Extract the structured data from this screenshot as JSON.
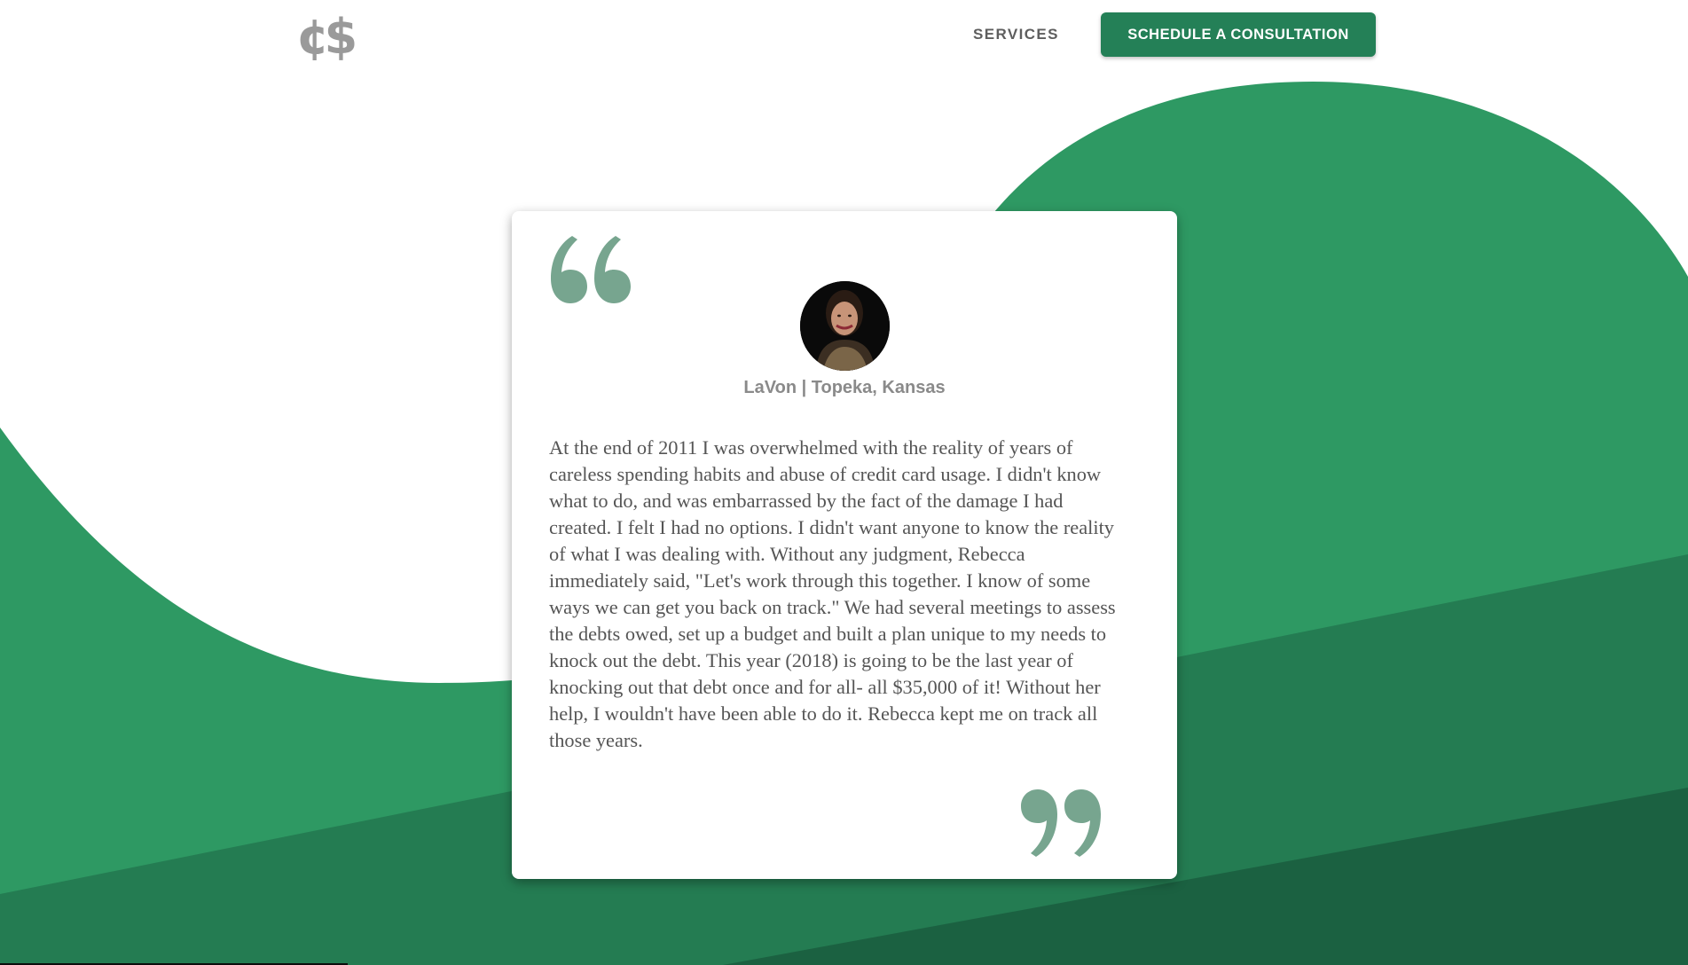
{
  "header": {
    "logo_text": "¢$",
    "nav_services": "SERVICES",
    "cta_label": "SCHEDULE A CONSULTATION"
  },
  "testimonial": {
    "author": "LaVon | Topeka, Kansas",
    "text": "At the end of 2011 I was overwhelmed with the reality of years of careless spending habits and abuse of credit card usage. I didn't know what to do, and was embarrassed by the fact of the damage I had created. I felt I had no options. I didn't want anyone to know the reality of what I was dealing with. Without any judgment, Rebecca immediately said, \"Let's work through this together. I know of some ways we can get you back on track.\" We had several meetings to assess the debts owed, set up a budget and built a plan unique to my needs to knock out the debt. This year (2018) is going to be the last year of knocking out that debt once and for all- all $35,000 of it! Without her help, I wouldn't have been able to do it. Rebecca kept me on track all those years."
  },
  "colors": {
    "green_primary": "#2e9963",
    "green_mid": "#247c52",
    "green_dark": "#1b6141",
    "button": "#248057",
    "quote_marks": "#77a58f"
  },
  "icons": {
    "logo": "cent-dollar-logo",
    "open_quote": "open-quote-icon",
    "close_quote": "close-quote-icon"
  }
}
